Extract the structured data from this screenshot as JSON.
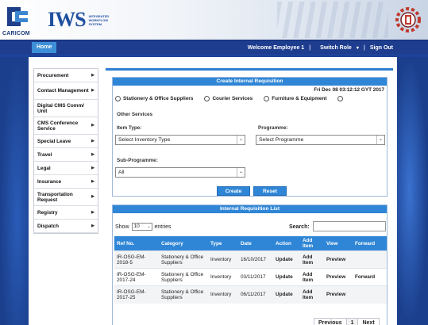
{
  "header": {
    "caricom_text": "CARICOM",
    "iws_mark": "IWS",
    "iws_sub": [
      "INTEGRATED",
      "WORKFLOW",
      "SYSTEM"
    ]
  },
  "nav": {
    "home": "Home",
    "welcome": "Welcome Employee 1",
    "switch_role": "Switch Role",
    "sign_out": "Sign Out"
  },
  "menu": [
    {
      "label": "Procurement",
      "arrow": true
    },
    {
      "label": "Contact Management",
      "arrow": true
    },
    {
      "label": "Digital CMS Comm/ Unit",
      "arrow": false
    },
    {
      "label": "CMS Conference Service",
      "arrow": true
    },
    {
      "label": "Special Leave",
      "arrow": true
    },
    {
      "label": "Travel",
      "arrow": true
    },
    {
      "label": "Legal",
      "arrow": true
    },
    {
      "label": "Insurance",
      "arrow": true
    },
    {
      "label": "Transportation Request",
      "arrow": true
    },
    {
      "label": "Registry",
      "arrow": true
    },
    {
      "label": "Dispatch",
      "arrow": true
    }
  ],
  "create_panel": {
    "title": "Create Internal Requisition",
    "datetime": "Fri Dec 08 03:12:12 GYT 2017",
    "radios": [
      {
        "label": "Stationery & Office Suppliers"
      },
      {
        "label": "Courier Services"
      },
      {
        "label": "Furniture & Equipment"
      },
      {
        "label": ""
      }
    ],
    "other_services": "Other Services",
    "item_type_label": "Item Type:",
    "item_type_value": "Select Inventory Type",
    "programme_label": "Programme:",
    "programme_value": "Select Programme",
    "subprogramme_label": "Sub-Programme:",
    "subprogramme_value": "All",
    "create_btn": "Create",
    "reset_btn": "Reset"
  },
  "list_panel": {
    "title": "Internal Requisition List",
    "show": "Show",
    "entries_value": "10",
    "entries": "entries",
    "search": "Search:",
    "columns": [
      "Ref No.",
      "Category",
      "Type",
      "Date",
      "Action",
      "Add Item",
      "View",
      "Forward"
    ],
    "rows": [
      {
        "ref": "IR-OSG-EM-2018-5",
        "category": "Stationery & Office Suppliers",
        "type": "Inventory",
        "date": "16/10/2017",
        "action": "Update",
        "add": "Add Item",
        "view": "Preview",
        "forward": ""
      },
      {
        "ref": "IR-OSG-EM-2017-24",
        "category": "Stationery & Office Suppliers",
        "type": "Inventory",
        "date": "03/11/2017",
        "action": "Update",
        "add": "Add Item",
        "view": "Preview",
        "forward": "Forward"
      },
      {
        "ref": "IR-OSG-EM-2017-25",
        "category": "Stationery & Office Suppliers",
        "type": "Inventory",
        "date": "06/11/2017",
        "action": "Update",
        "add": "Add Item",
        "view": "Preview",
        "forward": ""
      }
    ],
    "pager": {
      "previous": "Previous",
      "current": "1",
      "next": "Next"
    }
  }
}
